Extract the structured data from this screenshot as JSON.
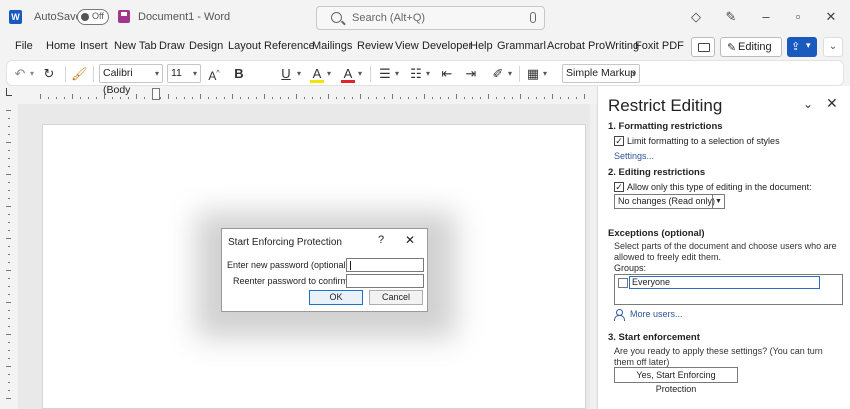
{
  "app": {
    "autosave_label": "AutoSave",
    "autosave_state": "Off",
    "doc_title": "Document1 - Word",
    "search_placeholder": "Search (Alt+Q)"
  },
  "tabs": [
    "File",
    "Home",
    "Insert",
    "New Tab",
    "Draw",
    "Design",
    "Layout",
    "Reference",
    "Mailings",
    "Review",
    "View",
    "Developer",
    "Help",
    "Grammarl",
    "Acrobat",
    "ProWriting",
    "Foxit PDF"
  ],
  "ribbon_right": {
    "editing_label": "Editing"
  },
  "toolbar": {
    "font_name": "Calibri (Body",
    "font_size": "11",
    "bold": "B",
    "underline": "U",
    "highlight": "A",
    "font_color": "A",
    "markup_mode": "Simple Markup",
    "highlight_color": "#f5e400",
    "font_color_hex": "#e0262c"
  },
  "dialog": {
    "title": "Start Enforcing Protection",
    "help": "?",
    "close": "✕",
    "new_password_label": "Enter new password (optional):",
    "new_password_value": "",
    "confirm_password_label": "Reenter password to confirm:",
    "confirm_password_value": "",
    "ok_label": "OK",
    "cancel_label": "Cancel"
  },
  "pane": {
    "title": "Restrict Editing",
    "section1_heading": "1. Formatting restrictions",
    "section1_checkbox_label": "Limit formatting to a selection of styles",
    "section1_checked": true,
    "settings_link": "Settings...",
    "section2_heading": "2. Editing restrictions",
    "section2_checkbox_label": "Allow only this type of editing in the document:",
    "section2_checked": true,
    "editing_type_value": "No changes (Read only)",
    "exceptions_heading": "Exceptions (optional)",
    "exceptions_desc": "Select parts of the document and choose users who are allowed to freely edit them.",
    "groups_label": "Groups:",
    "groups_everyone": "Everyone",
    "more_users_link": "More users...",
    "section3_heading": "3. Start enforcement",
    "section3_desc": "Are you ready to apply these settings? (You can turn them off later)",
    "start_button": "Yes, Start Enforcing Protection"
  },
  "colors": {
    "accent": "#185abd",
    "link": "#2b579a",
    "save_icon": "#a4348e"
  }
}
